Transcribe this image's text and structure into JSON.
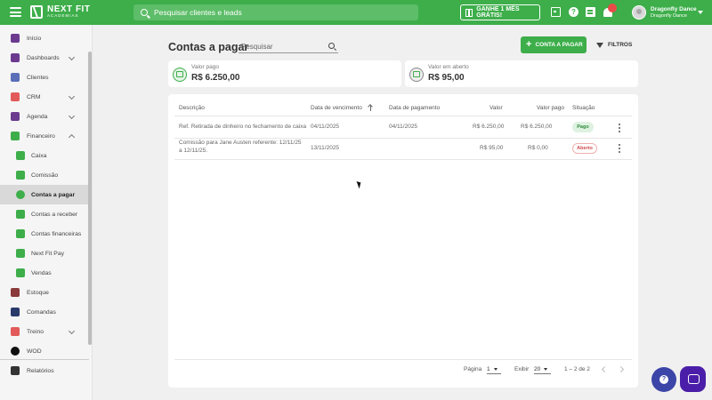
{
  "header": {
    "brand_name": "NEXT FIT",
    "brand_sub": "ACADEMIAS",
    "search_placeholder": "Pesquisar clientes e leads",
    "promo_label": "GANHE 1 MÊS GRÁTIS!",
    "user_name": "Dragonfly Dance",
    "user_sub": "Dragonfly Dance"
  },
  "sidebar": {
    "items": [
      {
        "label": "Início",
        "icon": "home-icon",
        "color": "#6b3a8f"
      },
      {
        "label": "Dashboards",
        "icon": "chart-line-icon",
        "color": "#6b3a8f"
      },
      {
        "label": "Clientes",
        "icon": "people-icon",
        "color": "#5a6fb8"
      },
      {
        "label": "CRM",
        "icon": "crm-icon",
        "color": "#e35a5a"
      },
      {
        "label": "Agenda",
        "icon": "calendar-icon",
        "color": "#6b3a8f"
      },
      {
        "label": "Financeiro",
        "icon": "money-icon",
        "color": "#3dae4a"
      },
      {
        "label": "Caixa",
        "icon": "cash-register-icon",
        "color": "#3dae4a"
      },
      {
        "label": "Comissão",
        "icon": "trend-icon",
        "color": "#3dae4a"
      },
      {
        "label": "Contas a pagar",
        "icon": "coin-icon",
        "color": "#3dae4a"
      },
      {
        "label": "Contas a receber",
        "icon": "dollar-icon",
        "color": "#3dae4a"
      },
      {
        "label": "Contas financeiras",
        "icon": "wallet-icon",
        "color": "#3dae4a"
      },
      {
        "label": "Next Fit Pay",
        "icon": "card-icon",
        "color": "#3dae4a"
      },
      {
        "label": "Vendas",
        "icon": "sales-icon",
        "color": "#3dae4a"
      },
      {
        "label": "Estoque",
        "icon": "cart-icon",
        "color": "#8a3a3a"
      },
      {
        "label": "Comandas",
        "icon": "receipt-icon",
        "color": "#2a3a6a"
      },
      {
        "label": "Treino",
        "icon": "dumbbell-icon",
        "color": "#e35a5a"
      },
      {
        "label": "WOD",
        "icon": "kettlebell-icon",
        "color": "#111111"
      },
      {
        "label": "Relatórios",
        "icon": "report-icon",
        "color": "#333333"
      }
    ]
  },
  "main": {
    "title": "Contas a pagar",
    "search_placeholder": "Pesquisar",
    "add_button": "CONTA A PAGAR",
    "filter_button": "FILTROS",
    "kpis": [
      {
        "label": "Valor pago",
        "value": "R$ 6.250,00"
      },
      {
        "label": "Valor em aberto",
        "value": "R$ 95,00"
      }
    ],
    "table": {
      "headers": [
        "Descrição",
        "Data de vencimento",
        "Data de pagamento",
        "Valor",
        "Valor pago",
        "Situação"
      ],
      "rows": [
        {
          "descricao": "Ref. Retirada de dinheiro no fechamento de caixa",
          "vencimento": "04/11/2025",
          "pagamento": "04/11/2025",
          "valor": "R$ 6.250,00",
          "valor_pago": "R$ 6.250,00",
          "situacao": "Pago"
        },
        {
          "descricao_1": "Comissão para Jane Austen referente: 12/11/25",
          "descricao_2": "a 12/11/25.",
          "vencimento": "13/11/2025",
          "pagamento": "",
          "valor": "R$ 95,00",
          "valor_pago": "R$ 0,00",
          "situacao": "Aberto"
        }
      ]
    },
    "pagination": {
      "page_label": "Página",
      "page_value": "1",
      "show_label": "Exibir",
      "show_value": "20",
      "range": "1 – 2 de 2"
    }
  },
  "colors": {
    "brand": "#3dae4a",
    "paid": "#2d8a3a",
    "open": "#d14b4b",
    "fab_help": "#3c46a8",
    "fab_chat": "#4a1ea8"
  }
}
